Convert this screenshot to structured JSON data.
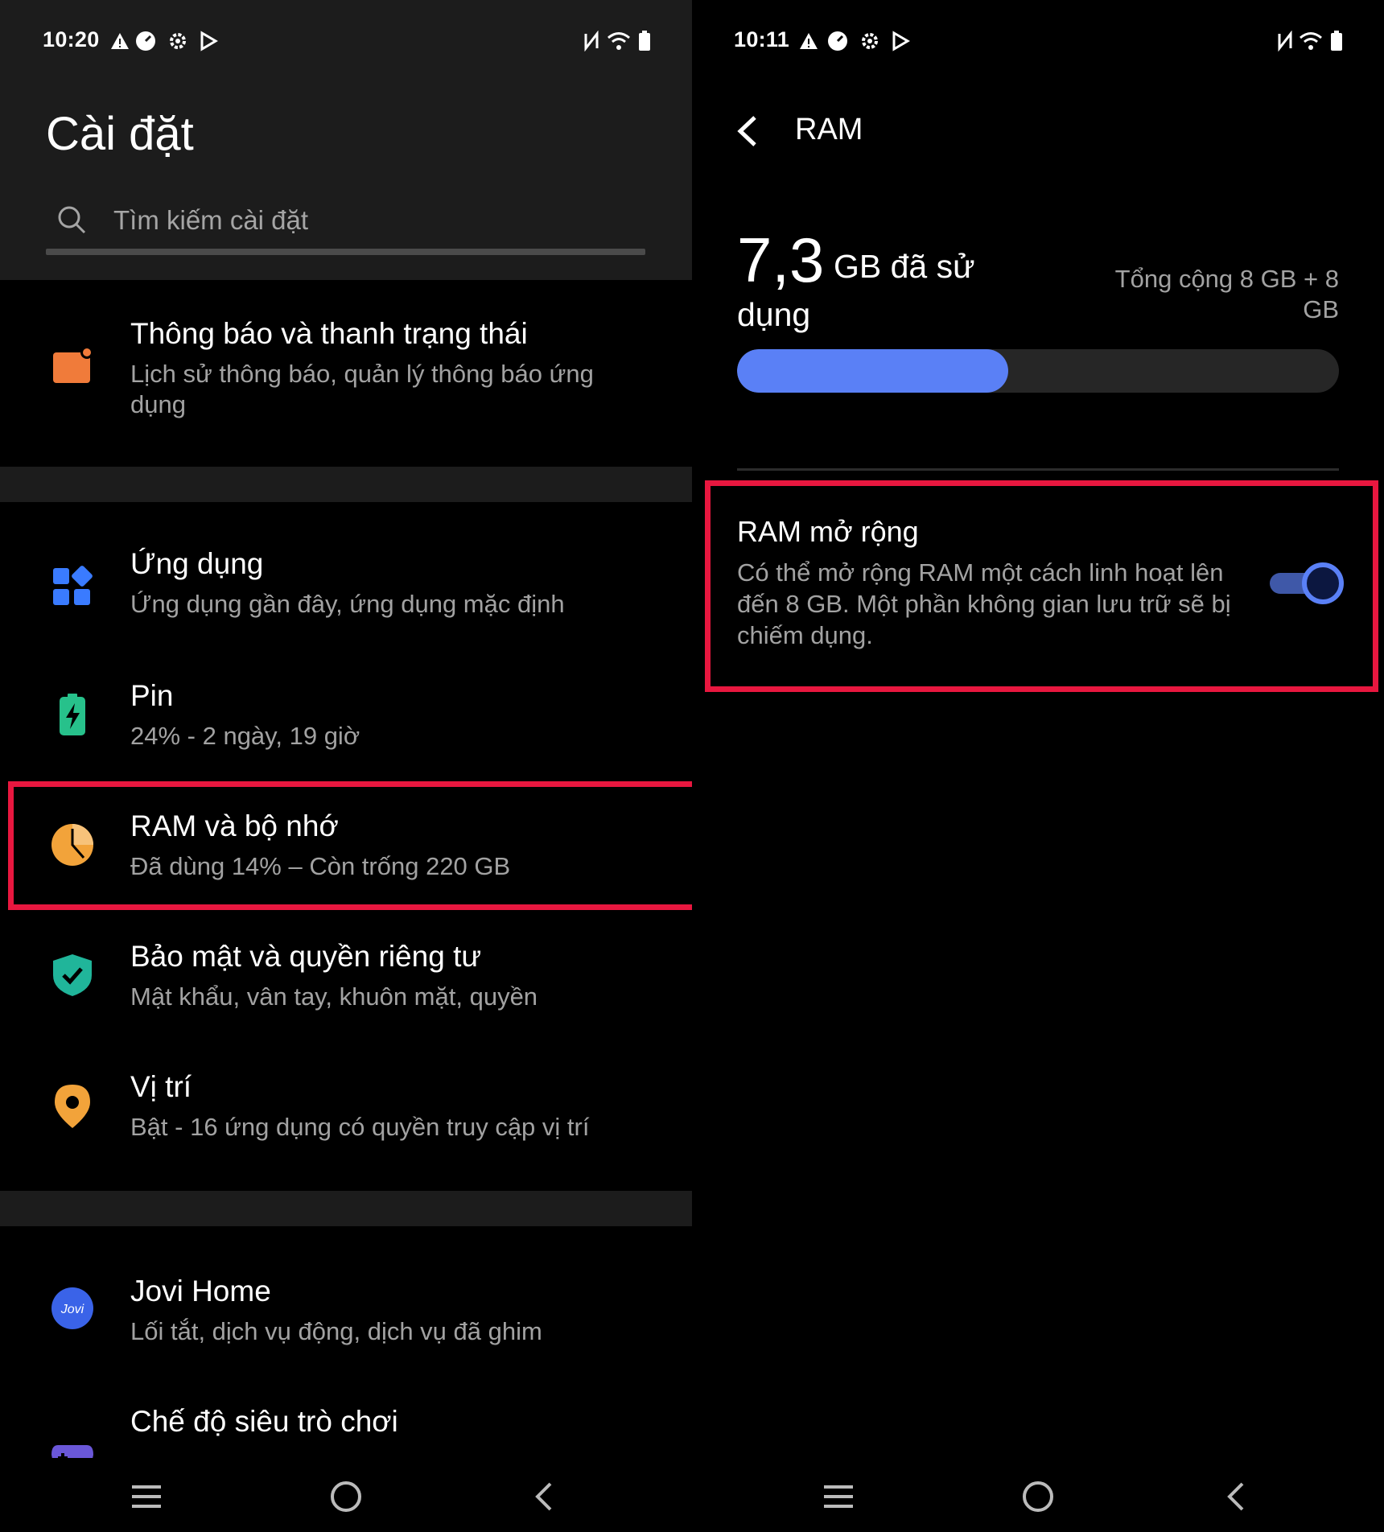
{
  "left": {
    "status_time": "10:20",
    "title": "Cài đặt",
    "search_placeholder": "Tìm kiếm cài đặt",
    "items": [
      {
        "title": "Thông báo và thanh trạng thái",
        "sub": "Lịch sử thông báo, quản lý thông báo ứng dụng",
        "icon": "notification-icon",
        "color": "#f07b3a"
      },
      {
        "title": "Ứng dụng",
        "sub": "Ứng dụng gần đây, ứng dụng mặc định",
        "icon": "apps-grid-icon",
        "color": "#3a7bff"
      },
      {
        "title": "Pin",
        "sub": "24% - 2 ngày, 19 giờ",
        "icon": "battery-icon",
        "color": "#27c18b"
      },
      {
        "title": "RAM và bộ nhớ",
        "sub": "Đã dùng 14% – Còn trống 220 GB",
        "icon": "pie-chart-icon",
        "color": "#f2a33a"
      },
      {
        "title": "Bảo mật và quyền riêng tư",
        "sub": "Mật khẩu, vân tay, khuôn mặt, quyền",
        "icon": "shield-icon",
        "color": "#20b59a"
      },
      {
        "title": "Vị trí",
        "sub": "Bật - 16 ứng dụng có quyền truy cập vị trí",
        "icon": "location-pin-icon",
        "color": "#f2a33a"
      },
      {
        "title": "Jovi Home",
        "sub": "Lối tắt, dịch vụ động, dịch vụ đã ghim",
        "icon": "jovi-icon",
        "icon_label": "Jovi",
        "color": "#3a63e8"
      },
      {
        "title": "Chế độ siêu trò chơi",
        "icon": "gamepad-icon",
        "color": "#6a57d8"
      }
    ]
  },
  "right": {
    "status_time": "10:11",
    "title": "RAM",
    "used_value": "7,3",
    "used_unit_line1": "GB đã sử",
    "used_unit_line2": "dụng",
    "total_text": "Tổng cộng 8 GB + 8 GB",
    "used_fraction": 0.45,
    "expanded": {
      "title": "RAM mở rộng",
      "desc": "Có thể mở rộng RAM một cách linh hoạt lên đến 8 GB. Một phần không gian lưu trữ sẽ bị chiếm dụng.",
      "enabled": true
    }
  },
  "colors": {
    "accent": "#5a80f6",
    "highlight": "#e8173f",
    "header_bg": "#1c1c1c"
  }
}
